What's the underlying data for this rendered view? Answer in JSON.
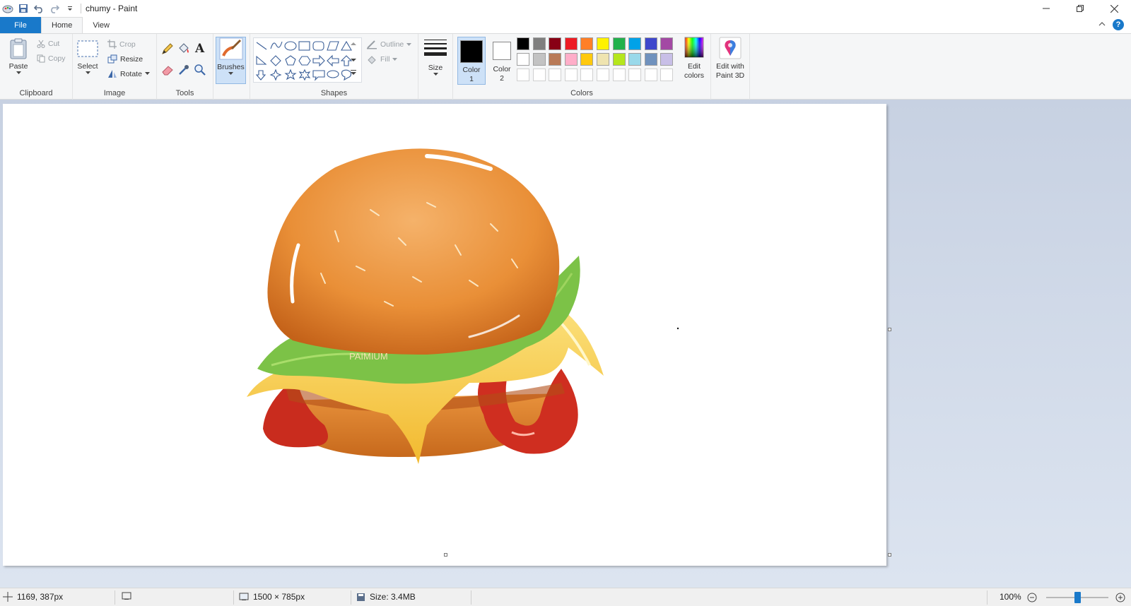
{
  "window": {
    "title": "chumy - Paint",
    "controls": [
      "minimize-icon",
      "restore-icon",
      "close-icon"
    ]
  },
  "quick_access": [
    "save-icon",
    "undo-icon",
    "redo-icon",
    "customize-dropdown-icon"
  ],
  "tabs": [
    {
      "label": "File"
    },
    {
      "label": "Home"
    },
    {
      "label": "View"
    }
  ],
  "ribbon": {
    "clipboard": {
      "label": "Clipboard",
      "paste": "Paste",
      "cut": "Cut",
      "copy": "Copy"
    },
    "image": {
      "label": "Image",
      "select": "Select",
      "crop": "Crop",
      "resize": "Resize",
      "rotate": "Rotate"
    },
    "tools": {
      "label": "Tools"
    },
    "brushes": {
      "label": "Brushes"
    },
    "shapes": {
      "label": "Shapes",
      "outline": "Outline",
      "fill": "Fill"
    },
    "size": {
      "label": "Size"
    },
    "colors": {
      "label": "Colors",
      "color1": "Color 1",
      "color1_line1": "Color",
      "color1_line2": "1",
      "color2_line1": "Color",
      "color2_line2": "2",
      "color1_value": "#000000",
      "color2_value": "#ffffff",
      "palette_row1": [
        "#000000",
        "#7f7f7f",
        "#880015",
        "#ed1c24",
        "#ff7f27",
        "#fff200",
        "#22b14c",
        "#00a2e8",
        "#3f48cc",
        "#a349a4"
      ],
      "palette_row2": [
        "#ffffff",
        "#c3c3c3",
        "#b97a57",
        "#ffaec9",
        "#ffc90e",
        "#efe4b0",
        "#b5e61d",
        "#99d9ea",
        "#7092be",
        "#c8bfe7"
      ],
      "edit_colors_line1": "Edit",
      "edit_colors_line2": "colors"
    },
    "paint3d": {
      "line1": "Edit with",
      "line2": "Paint 3D"
    }
  },
  "canvas": {
    "watermark": "PAIMIUM"
  },
  "status": {
    "cursor_position": "1169, 387px",
    "image_dimensions": "1500 × 785px",
    "file_size": "Size: 3.4MB",
    "zoom": "100%"
  }
}
